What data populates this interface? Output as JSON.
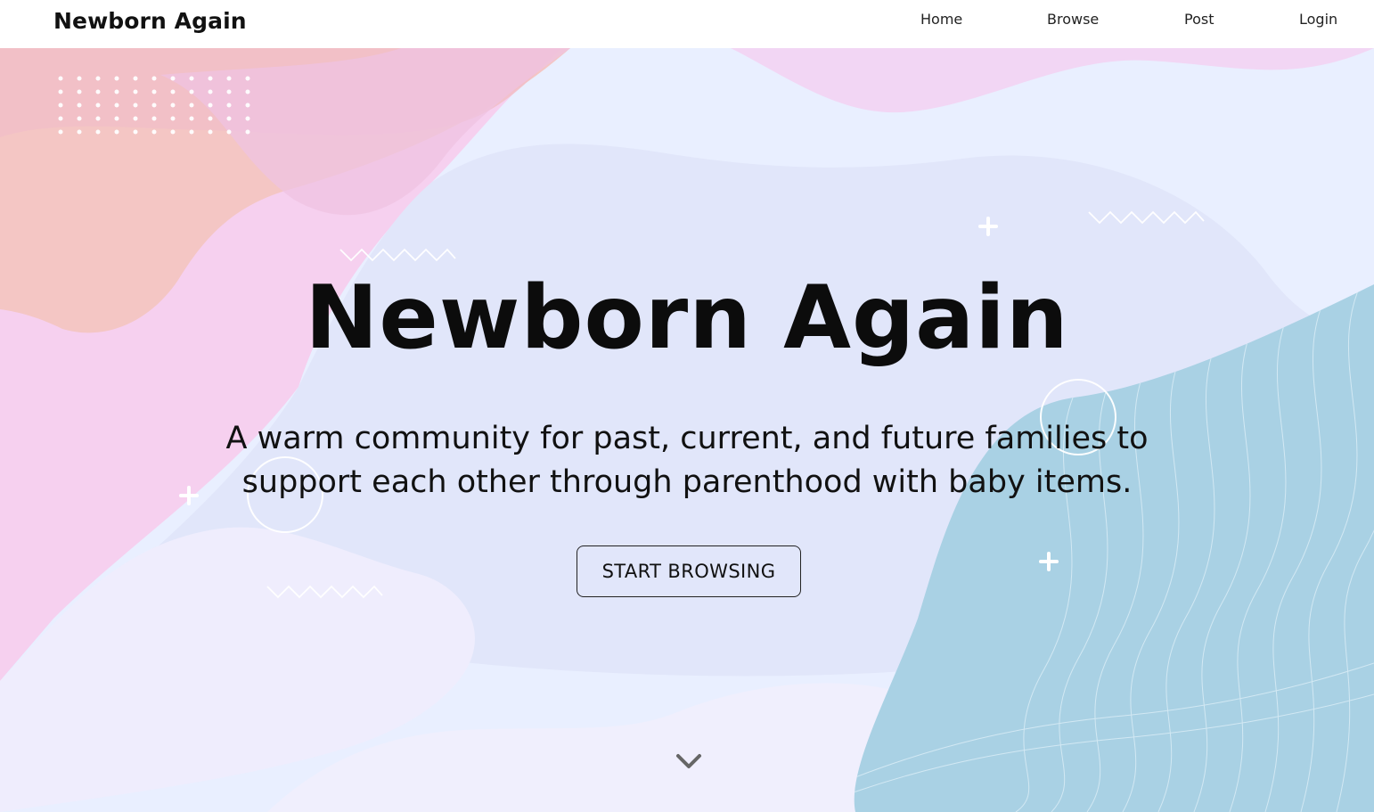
{
  "header": {
    "brand": "Newborn Again",
    "nav": [
      {
        "label": "Home"
      },
      {
        "label": "Browse"
      },
      {
        "label": "Post"
      },
      {
        "label": "Login"
      }
    ]
  },
  "hero": {
    "title": "Newborn Again",
    "subtitle": "A warm community for past, current, and future families to support each other through parenthood with baby items.",
    "cta_label": "START BROWSING",
    "scroll_icon": "chevron-down-icon"
  },
  "colors": {
    "pink": "#f3c3d0",
    "peach": "#f4c8c4",
    "lavender": "#e2e6f8",
    "light_lavender": "#ecedfc",
    "blue": "#a9d1e4",
    "chevron": "#666666"
  }
}
